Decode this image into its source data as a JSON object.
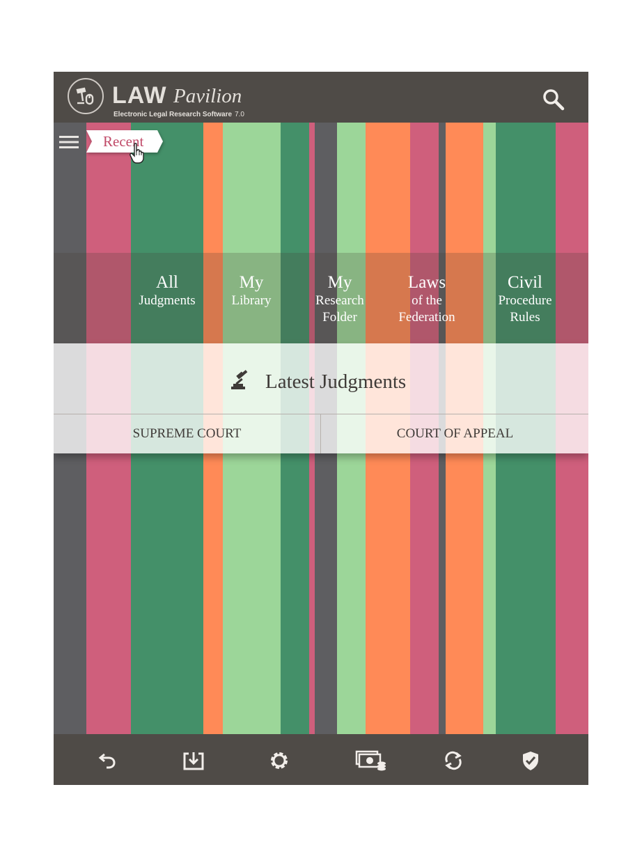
{
  "colors": {
    "header_bg": "#4f4b47",
    "footer_bg": "#4f4b47",
    "accent_pink": "#c04a68",
    "stripe_palette": [
      "#5e5e61",
      "#cf5f7c",
      "#449069",
      "#ff8a57",
      "#9cd699"
    ]
  },
  "header": {
    "logo_main": "LAW",
    "logo_script": "Pavilion",
    "tagline": "Electronic Legal Research Software",
    "version": "7.0",
    "search_icon": "search-icon"
  },
  "menu": {
    "icon": "hamburger-menu-icon",
    "recent_label": "Recent"
  },
  "nav": [
    {
      "line1": "All",
      "line2": "Judgments",
      "line3": ""
    },
    {
      "line1": "My",
      "line2": "Library",
      "line3": ""
    },
    {
      "line1": "My",
      "line2": "Research",
      "line3": "Folder"
    },
    {
      "line1": "Laws",
      "line2": "of the",
      "line3": "Federation"
    },
    {
      "line1": "Civil",
      "line2": "Procedure",
      "line3": "Rules"
    }
  ],
  "latest": {
    "icon": "gavel-icon",
    "title": "Latest Judgments",
    "tabs": [
      "SUPREME COURT",
      "COURT OF APPEAL"
    ]
  },
  "footer": {
    "icons": [
      "undo-icon",
      "download-icon",
      "settings-icon",
      "subscription-payment-icon",
      "sync-icon",
      "shield-check-icon"
    ]
  }
}
